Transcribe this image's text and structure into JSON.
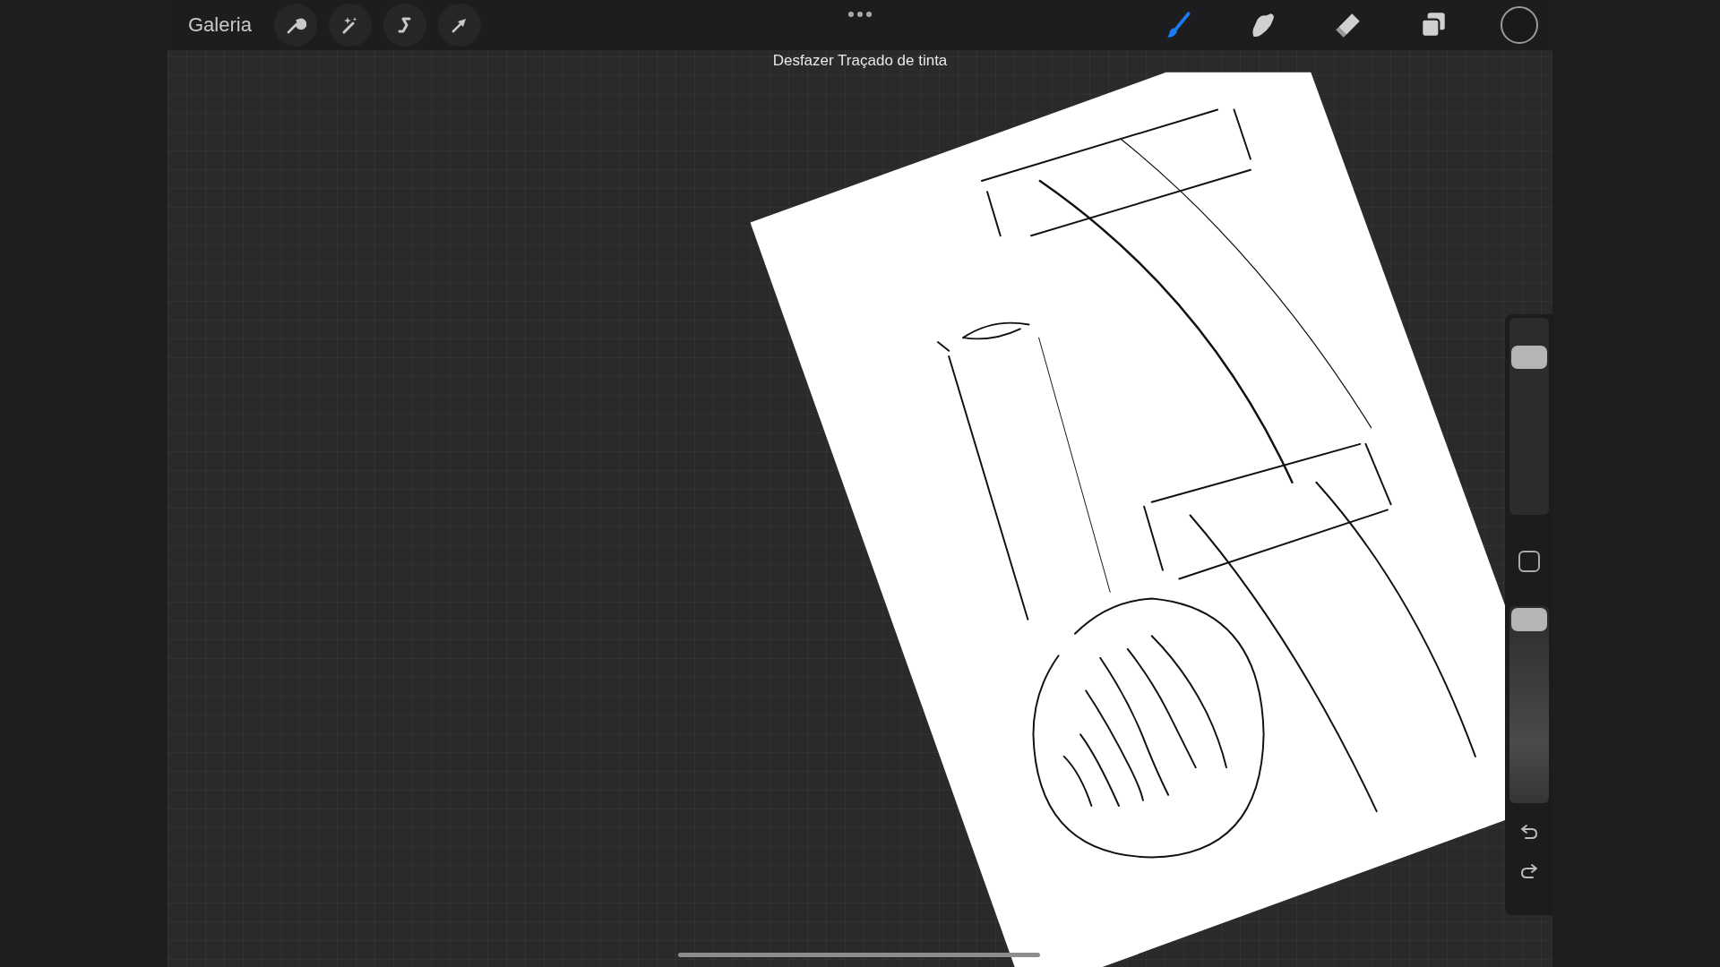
{
  "toolbar": {
    "gallery_label": "Galeria",
    "left_tools": [
      {
        "kind": "actions",
        "selected": false
      },
      {
        "kind": "adjustments",
        "selected": false
      },
      {
        "kind": "selection",
        "selected": false
      },
      {
        "kind": "transform",
        "selected": false
      }
    ],
    "right_tools": [
      {
        "kind": "brush",
        "selected": true
      },
      {
        "kind": "smudge",
        "selected": false
      },
      {
        "kind": "eraser",
        "selected": false
      },
      {
        "kind": "layers",
        "selected": false
      }
    ]
  },
  "toast": {
    "text": "Desfazer Traçado de tinta"
  },
  "sidebar": {
    "brush_size": {
      "level": 0.85
    },
    "opacity": {
      "level": 1
    }
  }
}
